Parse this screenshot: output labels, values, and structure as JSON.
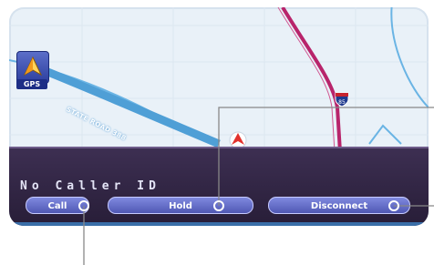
{
  "gps": {
    "label": "GPS"
  },
  "map": {
    "road_label": "STATE ROAD 388",
    "highway_shield": "85"
  },
  "call_panel": {
    "caller_id": "No Caller ID",
    "buttons": [
      {
        "label": "Call"
      },
      {
        "label": "Hold"
      },
      {
        "label": "Disconnect"
      }
    ]
  },
  "colors": {
    "panel": "#2e2240",
    "button": "#6a72cc",
    "map_background": "#e9f1f8",
    "highway": "#b8246b"
  }
}
